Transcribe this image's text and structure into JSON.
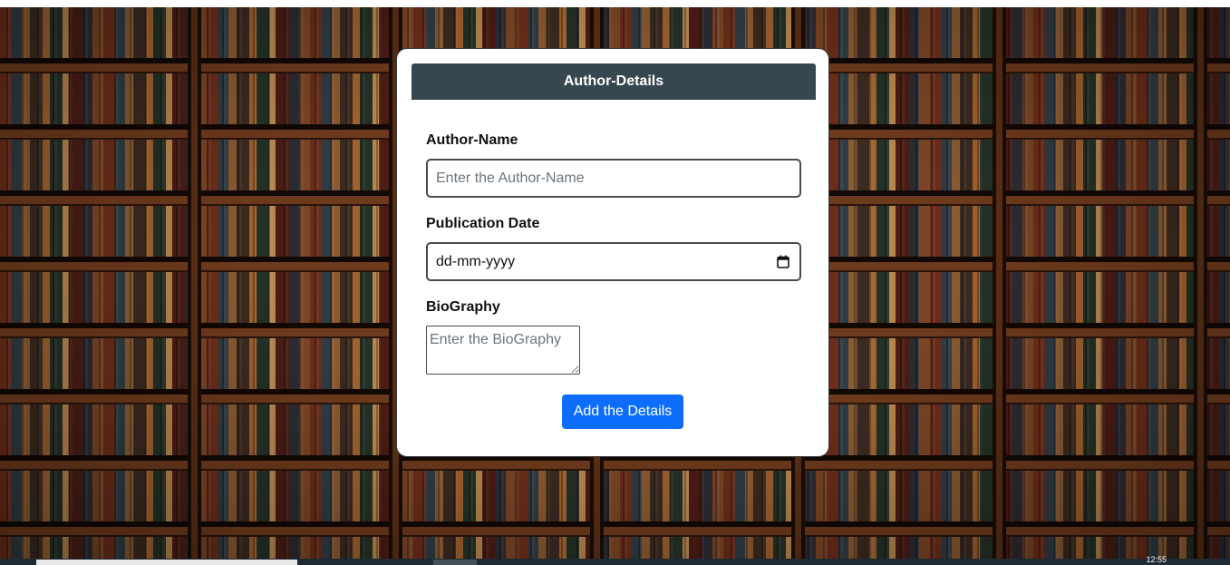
{
  "form": {
    "title": "Author-Details",
    "author_name": {
      "label": "Author-Name",
      "placeholder": "Enter the Author-Name",
      "value": ""
    },
    "publication_date": {
      "label": "Publication Date",
      "display": "dd-mm-yyyy",
      "icon": "calendar-icon"
    },
    "biography": {
      "label": "BioGraphy",
      "placeholder": "Enter the BioGraphy",
      "value": ""
    },
    "submit_label": "Add the Details"
  },
  "background": {
    "description_icon": "bookshelf-background"
  },
  "taskbar": {
    "clock": "12:55"
  },
  "colors": {
    "header_bg": "#37474f",
    "button_bg": "#0d6efd",
    "card_bg": "#ffffff"
  }
}
